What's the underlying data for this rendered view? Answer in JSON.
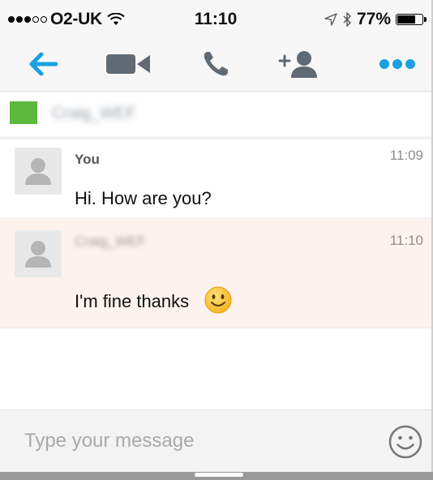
{
  "status_bar": {
    "carrier": "O2-UK",
    "signal_strength": 3,
    "signal_max": 5,
    "time": "11:10",
    "battery": "77%",
    "battery_level": 0.77
  },
  "toolbar": {
    "icons": [
      "back-arrow-icon",
      "video-camera-icon",
      "phone-icon",
      "add-contact-icon",
      "more-icon"
    ],
    "accent_color": "#1a9fe0",
    "icon_color": "#606a74"
  },
  "contact": {
    "name": "Craig_WEF",
    "flag_color": "#5bb93c"
  },
  "messages": [
    {
      "sender": "You",
      "time": "11:09",
      "text": "Hi. How are you?"
    },
    {
      "sender": "Craig_WEF",
      "time": "11:10",
      "text": "I'm fine thanks",
      "emoji": "smiling-face"
    }
  ],
  "composer": {
    "placeholder": "Type your message",
    "value": ""
  }
}
